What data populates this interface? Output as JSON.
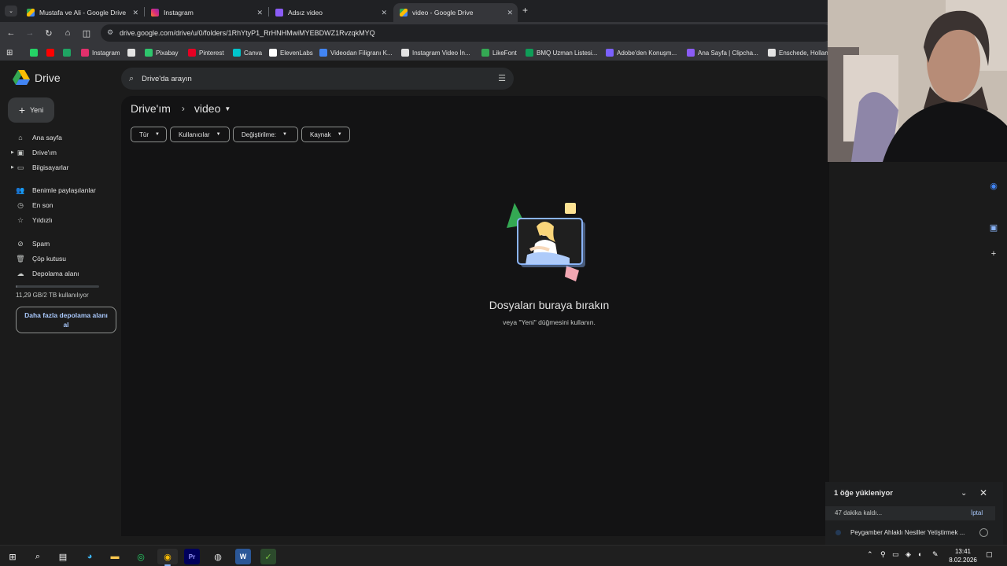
{
  "browser": {
    "tabs": [
      {
        "title": "Mustafa ve Ali - Google Drive",
        "favicon": "google-drive-icon",
        "active": false
      },
      {
        "title": "Instagram",
        "favicon": "instagram-icon",
        "active": false
      },
      {
        "title": "Adsız video",
        "favicon": "clipchamp-icon",
        "active": false
      },
      {
        "title": "video - Google Drive",
        "favicon": "google-drive-icon",
        "active": true
      }
    ],
    "new_tab": "+",
    "url": "drive.google.com/drive/u/0/folders/1RhYtyP1_RrHNHMwiMYEBDWZ1RvzqkMYQ",
    "bookmarks": [
      {
        "label": "",
        "icon": "whatsapp-icon",
        "color": "#25d366"
      },
      {
        "label": "",
        "icon": "youtube-icon",
        "color": "#ff0000"
      },
      {
        "label": "",
        "icon": "app-icon",
        "color": "#1fa463"
      },
      {
        "label": "Instagram",
        "icon": "instagram-icon",
        "color": "#e1306c"
      },
      {
        "label": "",
        "icon": "p-icon",
        "color": "#e3e3e3"
      },
      {
        "label": "Pixabay",
        "icon": "pixabay-icon",
        "color": "#2ec66d"
      },
      {
        "label": "Pinterest",
        "icon": "pinterest-icon",
        "color": "#e60023"
      },
      {
        "label": "Canva",
        "icon": "canva-icon",
        "color": "#00c4cc"
      },
      {
        "label": "ElevenLabs",
        "icon": "elevenlabs-icon",
        "color": "#ffffff"
      },
      {
        "label": "Videodan Filigranı K...",
        "icon": "watermark-icon",
        "color": "#4285f4"
      },
      {
        "label": "Instagram Video İn...",
        "icon": "download-icon",
        "color": "#e3e3e3"
      },
      {
        "label": "LikeFont",
        "icon": "likefont-icon",
        "color": "#34a853"
      },
      {
        "label": "BMQ Uzman Listesi...",
        "icon": "sheets-icon",
        "color": "#0f9d58"
      },
      {
        "label": "Adobe'den Konuşm...",
        "icon": "adobe-icon",
        "color": "#7b61ff"
      },
      {
        "label": "Ana Sayfa | Clipcha...",
        "icon": "clipchamp-icon",
        "color": "#8b5cf6"
      },
      {
        "label": "Enschede, Holland",
        "icon": "map-icon",
        "color": "#e3e3e3"
      }
    ]
  },
  "drive": {
    "product_name": "Drive",
    "search_placeholder": "Drive'da arayın",
    "new_button": "Yeni",
    "sidebar": [
      {
        "label": "Ana sayfa",
        "icon": "home-icon"
      },
      {
        "label": "Drive'ım",
        "icon": "my-drive-icon"
      },
      {
        "label": "Bilgisayarlar",
        "icon": "computers-icon"
      },
      {
        "label": "Benimle paylaşılanlar",
        "icon": "shared-icon"
      },
      {
        "label": "En son",
        "icon": "clock-icon"
      },
      {
        "label": "Yıldızlı",
        "icon": "star-icon"
      },
      {
        "label": "Spam",
        "icon": "spam-icon"
      },
      {
        "label": "Çöp kutusu",
        "icon": "trash-icon"
      },
      {
        "label": "Depolama alanı",
        "icon": "cloud-icon"
      }
    ],
    "storage_used_fraction": 0.006,
    "storage_text": "11,29 GB/2 TB kullanılıyor",
    "get_storage": "Daha fazla depolama alanı al",
    "breadcrumb_root": "Drive'ım",
    "breadcrumb_current": "video",
    "filters": [
      "Tür",
      "Kullanıcılar",
      "Değiştirilme:",
      "Kaynak"
    ],
    "empty_title": "Dosyaları buraya bırakın",
    "empty_subtitle": "veya \"Yeni\" düğmesini kullanın."
  },
  "upload": {
    "header": "1 öğe yükleniyor",
    "remaining": "47 dakika kaldı...",
    "cancel": "İptal",
    "file_name": "Peygamber Ahlaklı Nesiller Yetiştirmek ..."
  },
  "taskbar": {
    "time": "13:41",
    "date": "8.02.2026"
  }
}
